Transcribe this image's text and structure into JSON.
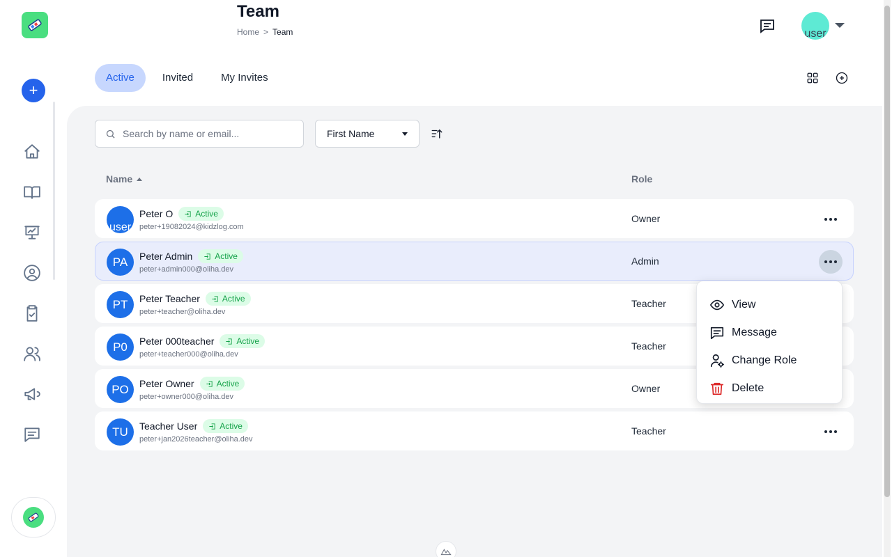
{
  "header": {
    "title": "Team",
    "breadcrumb": {
      "home": "Home",
      "separator": ">",
      "current": "Team"
    },
    "user_avatar_alt": "user"
  },
  "sidebar": {
    "add_label": "+",
    "items": [
      {
        "name": "home-icon"
      },
      {
        "name": "book-icon"
      },
      {
        "name": "presentation-icon"
      },
      {
        "name": "user-circle-icon"
      },
      {
        "name": "clipboard-check-icon"
      },
      {
        "name": "users-icon"
      },
      {
        "name": "megaphone-icon"
      },
      {
        "name": "message-icon"
      }
    ]
  },
  "tabs": [
    {
      "label": "Active",
      "active": true
    },
    {
      "label": "Invited",
      "active": false
    },
    {
      "label": "My Invites",
      "active": false
    }
  ],
  "filters": {
    "search_placeholder": "Search by name or email...",
    "sort_field": "First Name"
  },
  "table": {
    "columns": {
      "name": "Name",
      "role": "Role"
    },
    "rows": [
      {
        "initials": "user",
        "name": "Peter O",
        "status": "Active",
        "email": "peter+19082024@kidzlog.com",
        "role": "Owner"
      },
      {
        "initials": "PA",
        "name": "Peter Admin",
        "status": "Active",
        "email": "peter+admin000@oliha.dev",
        "role": "Admin"
      },
      {
        "initials": "PT",
        "name": "Peter Teacher",
        "status": "Active",
        "email": "peter+teacher@oliha.dev",
        "role": "Teacher"
      },
      {
        "initials": "P0",
        "name": "Peter 000teacher",
        "status": "Active",
        "email": "peter+teacher000@oliha.dev",
        "role": "Teacher"
      },
      {
        "initials": "PO",
        "name": "Peter Owner",
        "status": "Active",
        "email": "peter+owner000@oliha.dev",
        "role": "Owner"
      },
      {
        "initials": "TU",
        "name": "Teacher User",
        "status": "Active",
        "email": "peter+jan2026teacher@oliha.dev",
        "role": "Teacher"
      }
    ]
  },
  "context_menu": {
    "items": [
      {
        "label": "View",
        "icon": "eye-icon"
      },
      {
        "label": "Message",
        "icon": "message-icon"
      },
      {
        "label": "Change Role",
        "icon": "user-cog-icon"
      },
      {
        "label": "Delete",
        "icon": "trash-icon"
      }
    ]
  },
  "colors": {
    "primary": "#2563eb",
    "active_badge": "#16a34a",
    "danger": "#dc2626",
    "avatar": "#1d6fe8"
  }
}
